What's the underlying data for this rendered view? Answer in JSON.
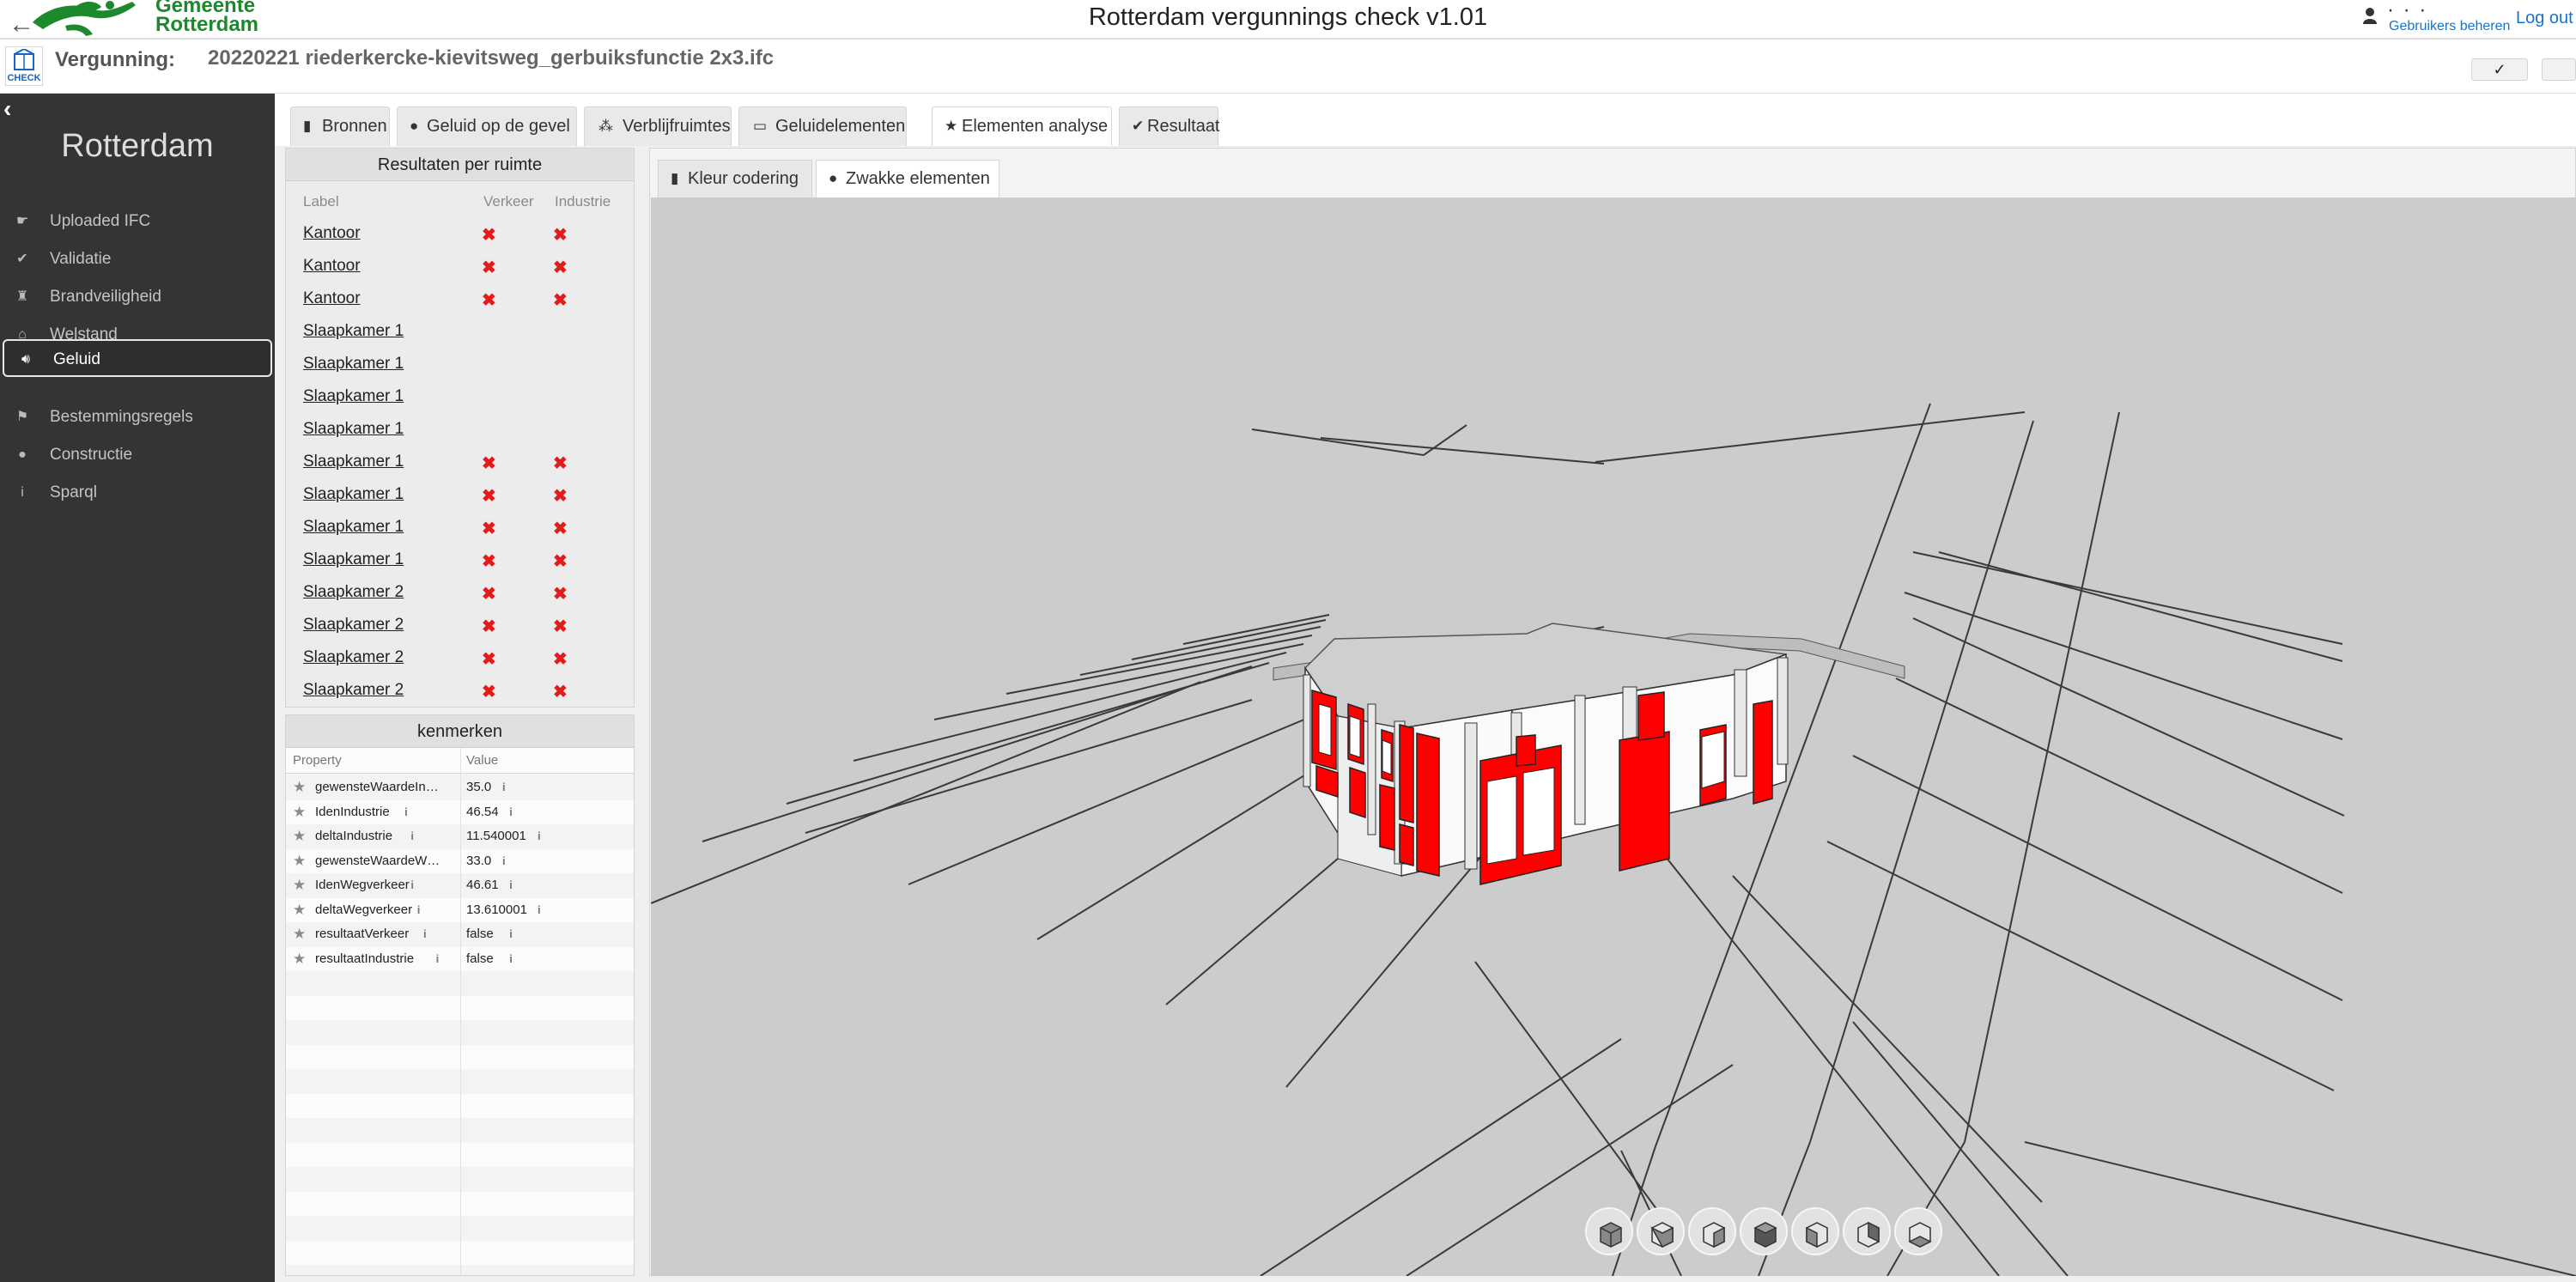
{
  "header": {
    "logo_text_line1": "Gemeente",
    "logo_text_line2": "Rotterdam",
    "app_title": "Rotterdam vergunnings check v1.01",
    "user_name": "· · ·",
    "admin_link": "Gebruikers beheren",
    "logout_label": "Log out"
  },
  "permit": {
    "logo_label": "CHECK",
    "label": "Vergunning:",
    "value": "20220221 riederkercke-kievitsweg_gerbuiksfunctie 2x3.ifc",
    "confirm_label": "✓"
  },
  "sidebar": {
    "title": "Rotterdam",
    "items": [
      {
        "label": "Uploaded IFC",
        "icon": "upload-icon",
        "active": false
      },
      {
        "label": "Validatie",
        "icon": "check-icon",
        "active": false
      },
      {
        "label": "Brandveiligheid",
        "icon": "fire-extinguisher-icon",
        "active": false
      },
      {
        "label": "Welstand",
        "icon": "building-icon",
        "active": false
      },
      {
        "label": "Geluid",
        "icon": "volume-icon",
        "active": true
      },
      {
        "label": "Bestemmingsregels",
        "icon": "map-pin-icon",
        "active": false
      },
      {
        "label": "Constructie",
        "icon": "circle-icon",
        "active": false
      },
      {
        "label": "Sparql",
        "icon": "info-icon",
        "active": false
      }
    ]
  },
  "tabs": [
    {
      "label": "Bronnen",
      "icon": "book-icon",
      "active": false
    },
    {
      "label": "Geluid op de gevel",
      "icon": "circle-icon",
      "active": false
    },
    {
      "label": "Verblijfruimtes",
      "icon": "sitemap-icon",
      "active": false
    },
    {
      "label": "Geluidelementen",
      "icon": "laptop-icon",
      "active": false
    },
    {
      "label": "Elementen analyse",
      "icon": "star-icon",
      "active": true
    },
    {
      "label": "Resultaat",
      "icon": "check-icon",
      "active": false
    }
  ],
  "results": {
    "title": "Resultaten per ruimte",
    "columns": [
      "Label",
      "Verkeer",
      "Industrie"
    ],
    "rows": [
      {
        "label": "Kantoor",
        "verkeer": "✖",
        "industrie": "✖"
      },
      {
        "label": "Kantoor",
        "verkeer": "✖",
        "industrie": "✖"
      },
      {
        "label": "Kantoor",
        "verkeer": "✖",
        "industrie": "✖"
      },
      {
        "label": "Slaapkamer 1",
        "verkeer": "",
        "industrie": ""
      },
      {
        "label": "Slaapkamer 1",
        "verkeer": "",
        "industrie": ""
      },
      {
        "label": "Slaapkamer 1",
        "verkeer": "",
        "industrie": ""
      },
      {
        "label": "Slaapkamer 1",
        "verkeer": "",
        "industrie": ""
      },
      {
        "label": "Slaapkamer 1",
        "verkeer": "✖",
        "industrie": "✖"
      },
      {
        "label": "Slaapkamer 1",
        "verkeer": "✖",
        "industrie": "✖"
      },
      {
        "label": "Slaapkamer 1",
        "verkeer": "✖",
        "industrie": "✖"
      },
      {
        "label": "Slaapkamer 1",
        "verkeer": "✖",
        "industrie": "✖"
      },
      {
        "label": "Slaapkamer 2",
        "verkeer": "✖",
        "industrie": "✖"
      },
      {
        "label": "Slaapkamer 2",
        "verkeer": "✖",
        "industrie": "✖"
      },
      {
        "label": "Slaapkamer 2",
        "verkeer": "✖",
        "industrie": "✖"
      },
      {
        "label": "Slaapkamer 2",
        "verkeer": "✖",
        "industrie": "✖"
      }
    ]
  },
  "kenmerken": {
    "title": "kenmerken",
    "columns": [
      "Property",
      "Value"
    ],
    "rows": [
      {
        "property": "gewensteWaardeIndus...",
        "value": "35.0"
      },
      {
        "property": "IdenIndustrie",
        "value": "46.54"
      },
      {
        "property": "deltaIndustrie",
        "value": "11.540001"
      },
      {
        "property": "gewensteWaardeWegv...",
        "value": "33.0"
      },
      {
        "property": "IdenWegverkeer",
        "value": "46.61"
      },
      {
        "property": "deltaWegverkeer",
        "value": "13.610001"
      },
      {
        "property": "resultaatVerkeer",
        "value": "false"
      },
      {
        "property": "resultaatIndustrie",
        "value": "false"
      }
    ]
  },
  "viewer": {
    "subtabs": [
      {
        "label": "Kleur codering",
        "icon": "book-icon",
        "active": false
      },
      {
        "label": "Zwakke elementen",
        "icon": "circle-icon",
        "active": true
      }
    ],
    "view_buttons": [
      "view-iso-icon",
      "view-front-icon",
      "view-right-icon",
      "view-top-icon",
      "view-left-icon",
      "view-back-icon",
      "view-bottom-icon"
    ],
    "colors": {
      "weak_element": "#ff0000",
      "model": "#ffffff",
      "background": "#cccccc",
      "grid": "#3a3a3a"
    }
  },
  "colors": {
    "sidebar_bg": "#343434",
    "brand_green": "#1c8a2c",
    "link_blue": "#1a73c7",
    "fail_red": "#e41b1b"
  }
}
